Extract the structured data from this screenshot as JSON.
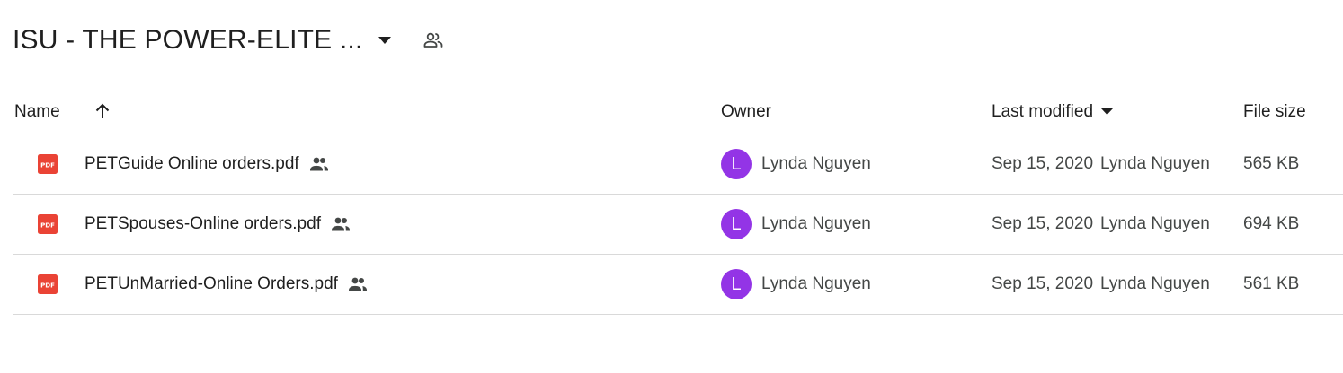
{
  "folder": {
    "title": "ISU - THE POWER-ELITE ..."
  },
  "columns": {
    "name": "Name",
    "owner": "Owner",
    "last_modified": "Last modified",
    "file_size": "File size"
  },
  "files": [
    {
      "name": "PETGuide Online orders.pdf",
      "owner": "Lynda Nguyen",
      "owner_initial": "L",
      "modified_date": "Sep 15, 2020",
      "modified_by": "Lynda Nguyen",
      "size": "565 KB"
    },
    {
      "name": "PETSpouses-Online orders.pdf",
      "owner": "Lynda Nguyen",
      "owner_initial": "L",
      "modified_date": "Sep 15, 2020",
      "modified_by": "Lynda Nguyen",
      "size": "694 KB"
    },
    {
      "name": "PETUnMarried-Online Orders.pdf",
      "owner": "Lynda Nguyen",
      "owner_initial": "L",
      "modified_date": "Sep 15, 2020",
      "modified_by": "Lynda Nguyen",
      "size": "561 KB"
    }
  ],
  "icons": {
    "file_type": "pdf-icon",
    "shared": "people-icon",
    "sort": "arrow-up-icon",
    "dropdown": "caret-down-icon"
  },
  "colors": {
    "pdf_red": "#ea4335",
    "avatar_purple": "#9334e6",
    "divider": "#d9d9d9"
  }
}
